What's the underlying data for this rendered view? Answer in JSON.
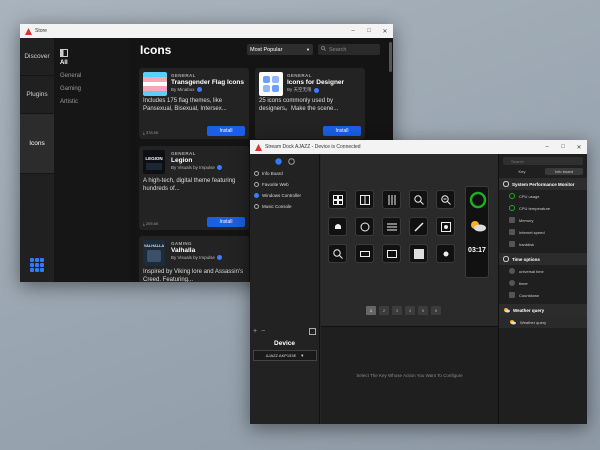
{
  "store": {
    "title": "Store",
    "nav": [
      "Discover",
      "Plugins",
      "Icons"
    ],
    "categories": [
      "All",
      "General",
      "Gaming",
      "Artistic"
    ],
    "heading": "Icons",
    "sort": "Most Popular",
    "search_placeholder": "Search",
    "cards": [
      {
        "category": "GENERAL",
        "name": "Transgender Flag Icons",
        "author": "By Minabox",
        "desc": "Includes 175 flag themes, like Pansexual, Bisexual, Intersex...",
        "downloads": "⤓ 378.5K",
        "install": "Install"
      },
      {
        "category": "GENERAL",
        "name": "Icons for Designer",
        "author": "By 天空无限",
        "desc": "25 icons commonly used by designers。Make the scene...",
        "downloads": "",
        "install": "Install"
      },
      {
        "category": "GENERAL",
        "name": "Legion",
        "author": "By Visuals by Impulse",
        "desc": "A high-tech, digital theme featuring hundreds of...",
        "downloads": "⤓ 205.6K",
        "install": "Install"
      },
      {
        "category": "GAMING",
        "name": "Valhalla",
        "author": "By Visuals by Impulse",
        "desc": "Inspired by Viking lore and Assassin's Creed. Featuring...",
        "downloads": "",
        "install": ""
      }
    ],
    "thumb_legion": "LEGION",
    "thumb_valhalla": "VALHALLA"
  },
  "dock": {
    "title": "Stream Dock AJAZZ - Device is Connected",
    "profiles": [
      "Info Board",
      "Favorite Web",
      "Windows Controller",
      "Music Console"
    ],
    "add": "+",
    "remove": "−",
    "device_label": "Device",
    "device_value": "AJAZZ AKP153E",
    "pages": [
      "1",
      "2",
      "3",
      "4",
      "5",
      "6"
    ],
    "clock": "03:17",
    "hint": "Select The Key Whose Action You Want To Configure",
    "search_placeholder": "Search",
    "tabs": [
      "Key",
      "Info board"
    ],
    "groups": [
      {
        "name": "System Performance Monitor",
        "items": [
          "CPU usage",
          "CPU temperature",
          "Memory",
          "Internet speed",
          "harddisk"
        ]
      },
      {
        "name": "Time options",
        "items": [
          "universal time",
          "timer",
          "Countdown"
        ]
      },
      {
        "name": "Weather query",
        "items": [
          "Weather query"
        ]
      }
    ]
  }
}
